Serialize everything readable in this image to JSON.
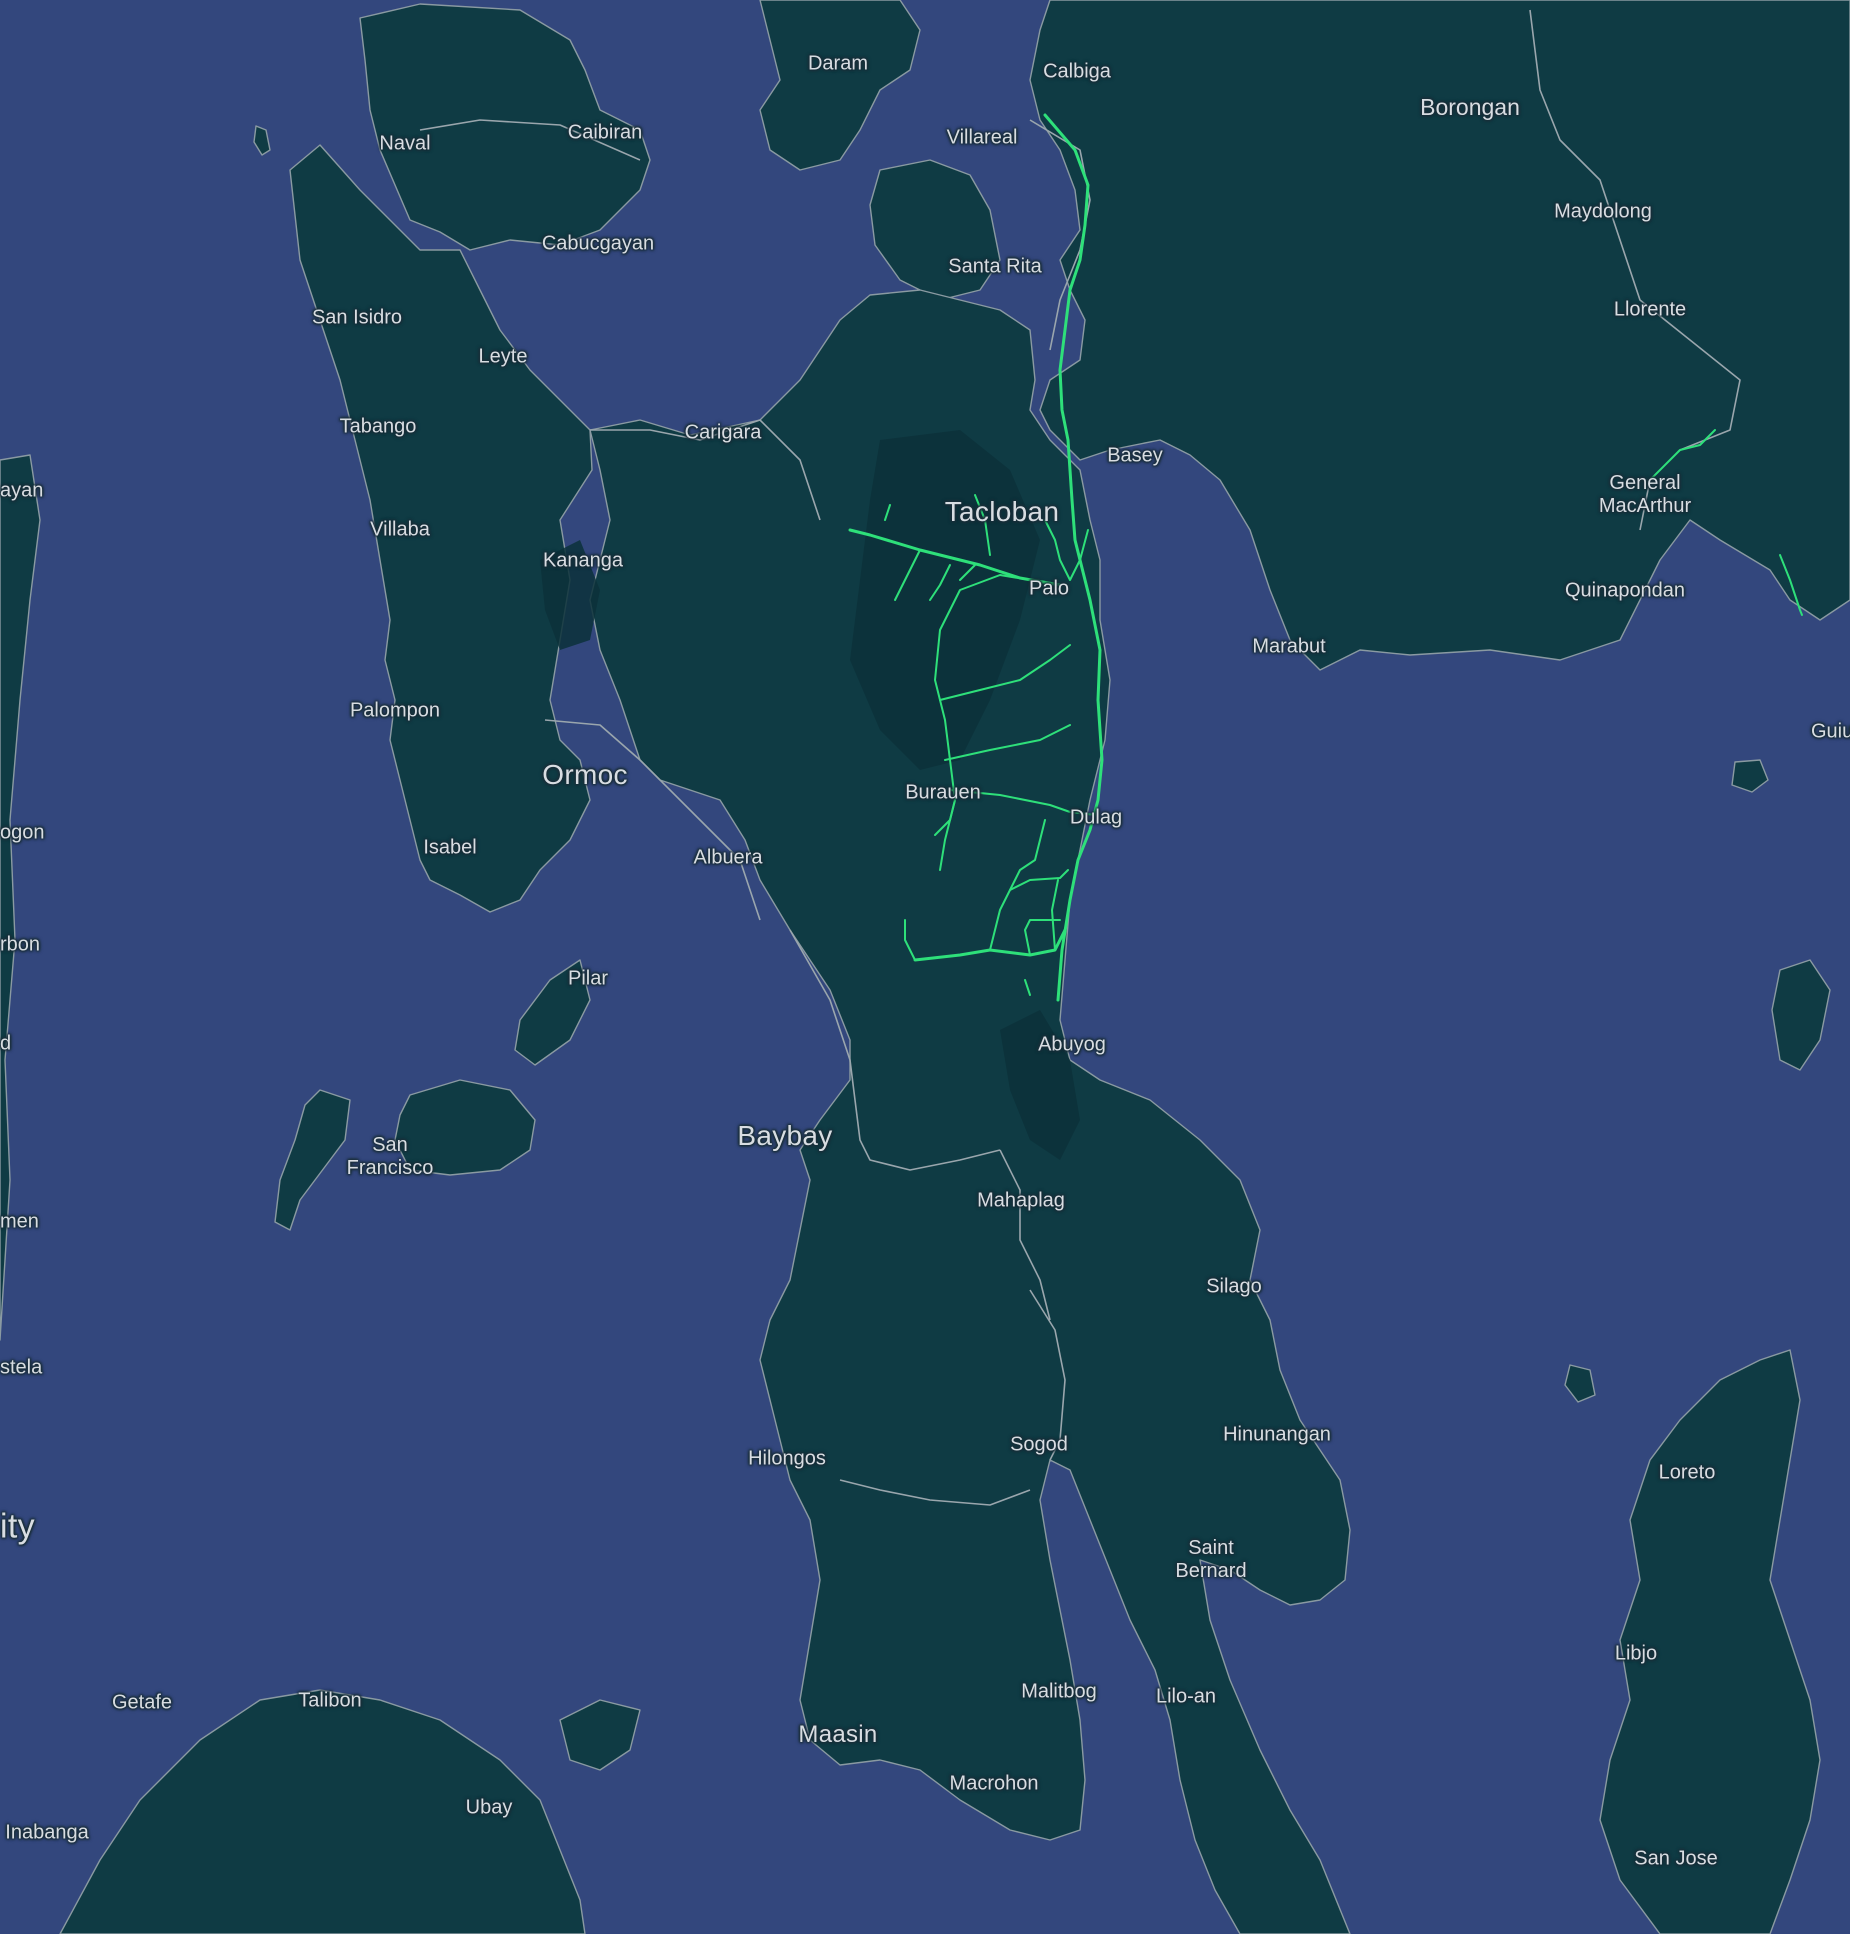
{
  "map": {
    "colors": {
      "water": "#34497f",
      "land": "#0f3b44",
      "border": "#9aa6ad",
      "route": "#2ee07a",
      "label": "#d8dde2"
    }
  },
  "places": [
    {
      "id": "daram",
      "name": "Daram",
      "major": false
    },
    {
      "id": "calbiga",
      "name": "Calbiga",
      "major": false
    },
    {
      "id": "borongan",
      "name": "Borongan",
      "major": false
    },
    {
      "id": "naval",
      "name": "Naval",
      "major": false
    },
    {
      "id": "caibiran",
      "name": "Caibiran",
      "major": false
    },
    {
      "id": "villareal",
      "name": "Villareal",
      "major": false
    },
    {
      "id": "maydolong",
      "name": "Maydolong",
      "major": false
    },
    {
      "id": "cabucgayan",
      "name": "Cabucgayan",
      "major": false
    },
    {
      "id": "santa-rita",
      "name": "Santa Rita",
      "major": false
    },
    {
      "id": "san-isidro",
      "name": "San Isidro",
      "major": false
    },
    {
      "id": "llorente",
      "name": "Llorente",
      "major": false
    },
    {
      "id": "leyte",
      "name": "Leyte",
      "major": false
    },
    {
      "id": "tabango",
      "name": "Tabango",
      "major": false
    },
    {
      "id": "carigara",
      "name": "Carigara",
      "major": false
    },
    {
      "id": "basey",
      "name": "Basey",
      "major": false
    },
    {
      "id": "general-macarthur",
      "name": "General\nMacArthur",
      "major": false
    },
    {
      "id": "ayan",
      "name": "ayan",
      "major": false
    },
    {
      "id": "tacloban",
      "name": "Tacloban",
      "major": true
    },
    {
      "id": "villaba",
      "name": "Villaba",
      "major": false
    },
    {
      "id": "kananga",
      "name": "Kananga",
      "major": false
    },
    {
      "id": "palo",
      "name": "Palo",
      "major": false
    },
    {
      "id": "quinapondan",
      "name": "Quinapondan",
      "major": false
    },
    {
      "id": "marabut",
      "name": "Marabut",
      "major": false
    },
    {
      "id": "palompon",
      "name": "Palompon",
      "major": false
    },
    {
      "id": "guiu",
      "name": "Guiu",
      "major": false
    },
    {
      "id": "ormoc",
      "name": "Ormoc",
      "major": true
    },
    {
      "id": "burauen",
      "name": "Burauen",
      "major": false
    },
    {
      "id": "dulag",
      "name": "Dulag",
      "major": false
    },
    {
      "id": "ogon",
      "name": "ogon",
      "major": false
    },
    {
      "id": "isabel",
      "name": "Isabel",
      "major": false
    },
    {
      "id": "albuera",
      "name": "Albuera",
      "major": false
    },
    {
      "id": "rbon",
      "name": "rbon",
      "major": false
    },
    {
      "id": "pilar",
      "name": "Pilar",
      "major": false
    },
    {
      "id": "d",
      "name": "d",
      "major": false
    },
    {
      "id": "abuyog",
      "name": "Abuyog",
      "major": false
    },
    {
      "id": "baybay",
      "name": "Baybay",
      "major": true
    },
    {
      "id": "san-francisco",
      "name": "San\nFrancisco",
      "major": false
    },
    {
      "id": "mahaplag",
      "name": "Mahaplag",
      "major": false
    },
    {
      "id": "men",
      "name": "men",
      "major": false
    },
    {
      "id": "silago",
      "name": "Silago",
      "major": false
    },
    {
      "id": "stela",
      "name": "stela",
      "major": false
    },
    {
      "id": "hinunangan",
      "name": "Hinunangan",
      "major": false
    },
    {
      "id": "sogod",
      "name": "Sogod",
      "major": false
    },
    {
      "id": "hilongos",
      "name": "Hilongos",
      "major": false
    },
    {
      "id": "loreto",
      "name": "Loreto",
      "major": false
    },
    {
      "id": "ity",
      "name": "ity",
      "major": true
    },
    {
      "id": "saint-bernard",
      "name": "Saint\nBernard",
      "major": false
    },
    {
      "id": "libjo",
      "name": "Libjo",
      "major": false
    },
    {
      "id": "malitbog",
      "name": "Malitbog",
      "major": false
    },
    {
      "id": "lilo-an",
      "name": "Lilo-an",
      "major": false
    },
    {
      "id": "getafe",
      "name": "Getafe",
      "major": false
    },
    {
      "id": "talibon",
      "name": "Talibon",
      "major": false
    },
    {
      "id": "maasin",
      "name": "Maasin",
      "major": true
    },
    {
      "id": "macrohon",
      "name": "Macrohon",
      "major": false
    },
    {
      "id": "ubay",
      "name": "Ubay",
      "major": false
    },
    {
      "id": "inabanga",
      "name": "Inabanga",
      "major": false
    },
    {
      "id": "san-jose",
      "name": "San Jose",
      "major": false
    }
  ]
}
